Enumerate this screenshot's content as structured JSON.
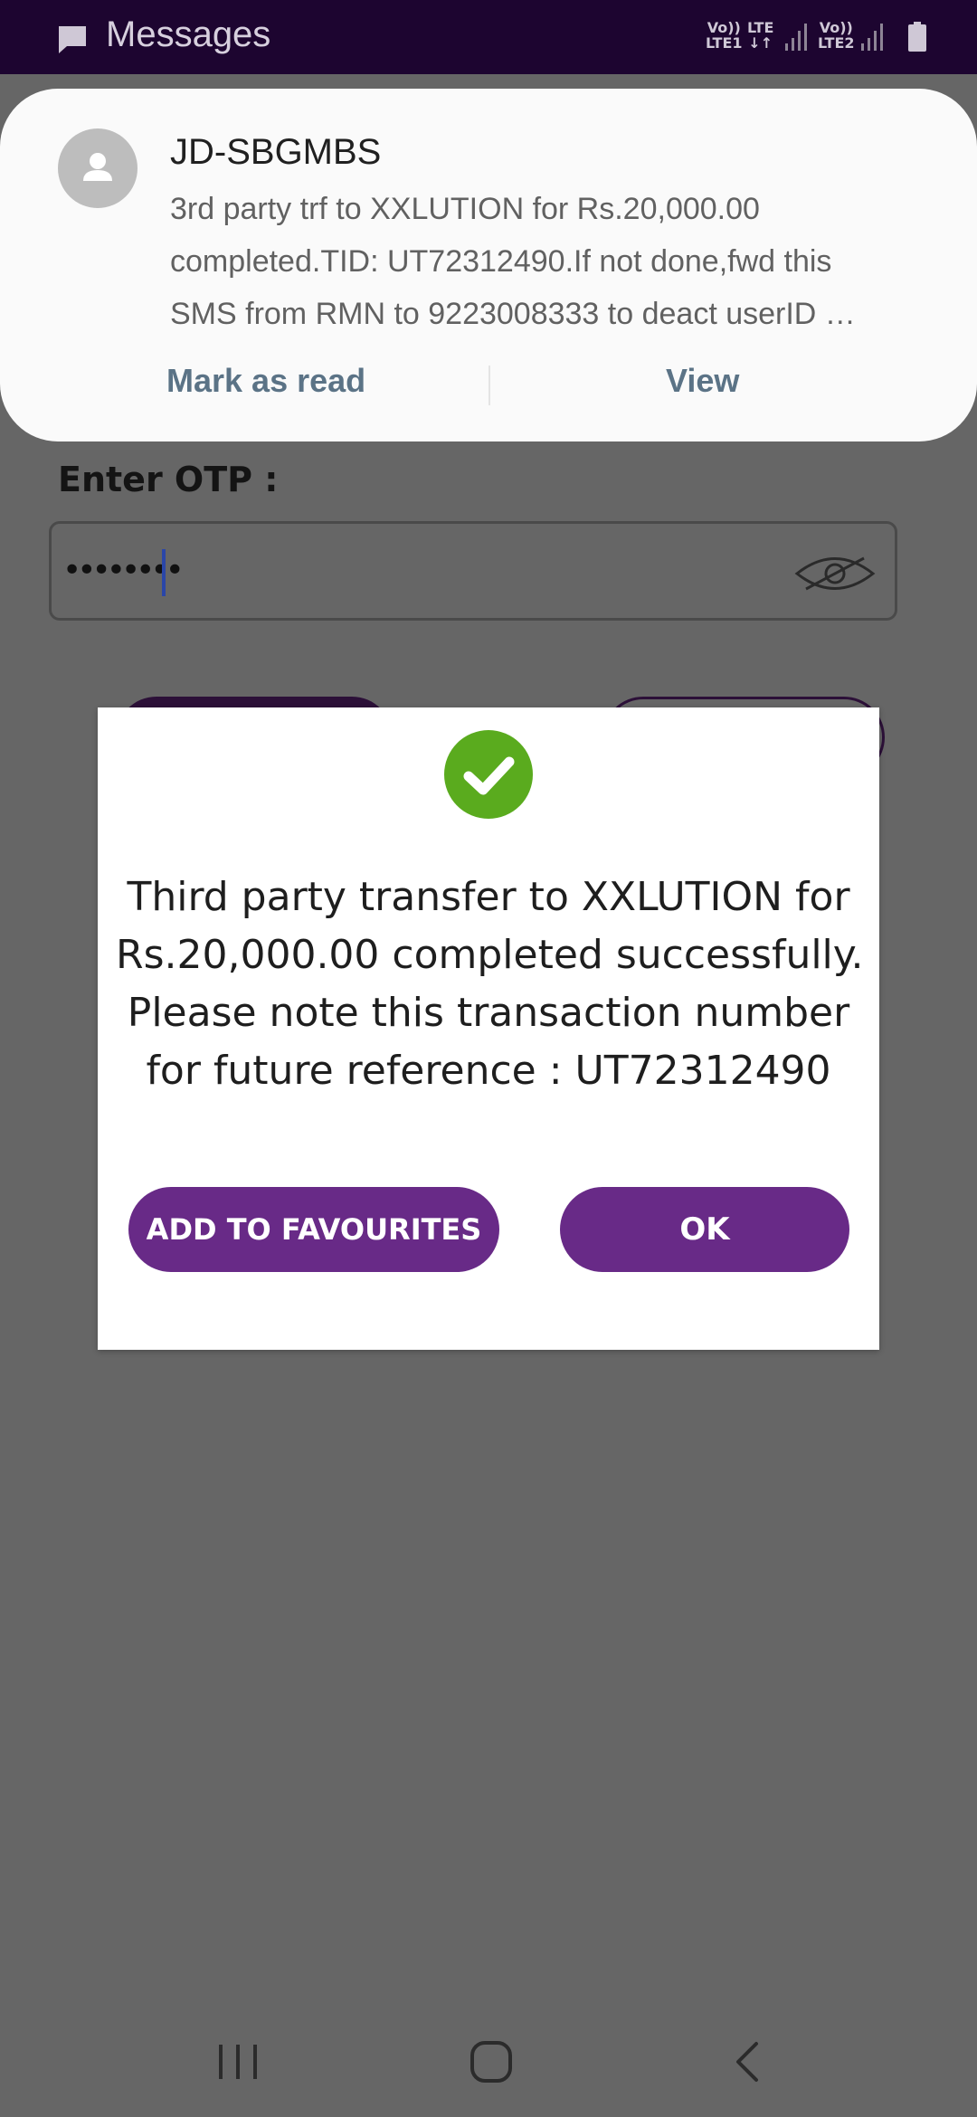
{
  "status_bar": {
    "app_name": "Messages",
    "app_icon": "message-icon",
    "sim1_network": "LTE1",
    "sim1_volte": "Vo))",
    "data_type": "LTE",
    "data_arrows": "↓↑",
    "sim2_network": "LTE2",
    "sim2_volte": "Vo))",
    "battery_icon": "battery-icon"
  },
  "notification": {
    "sender": "JD-SBGMBS",
    "avatar_icon": "person-avatar-icon",
    "body_lines": [
      "3rd party trf to XXLUTION for Rs.20,000.00",
      "completed.TID: UT72312490.If not done,fwd this",
      "SMS from RMN to 9223008333 to deact userID …"
    ],
    "actions": {
      "mark_read": "Mark as read",
      "view": "View"
    }
  },
  "background_screen": {
    "otp_label": "Enter OTP :",
    "otp_value": "••••••••",
    "visibility_icon": "eye-slash-icon"
  },
  "dialog": {
    "icon": "success-check-icon",
    "message_lines": [
      "Third party transfer to XXLUTION for",
      "Rs.20,000.00 completed successfully.",
      "Please note this transaction number",
      "for future reference : UT72312490"
    ],
    "buttons": {
      "favourites": "ADD TO FAVOURITES",
      "ok": "OK"
    },
    "colors": {
      "button": "#682a87",
      "success": "#5aab1e"
    }
  },
  "nav_bar": {
    "recent_icon": "recent-apps-icon",
    "home_icon": "home-icon",
    "back_icon": "back-icon"
  },
  "colors": {
    "status_bar": "#1d0530",
    "overlay": "#666666"
  }
}
